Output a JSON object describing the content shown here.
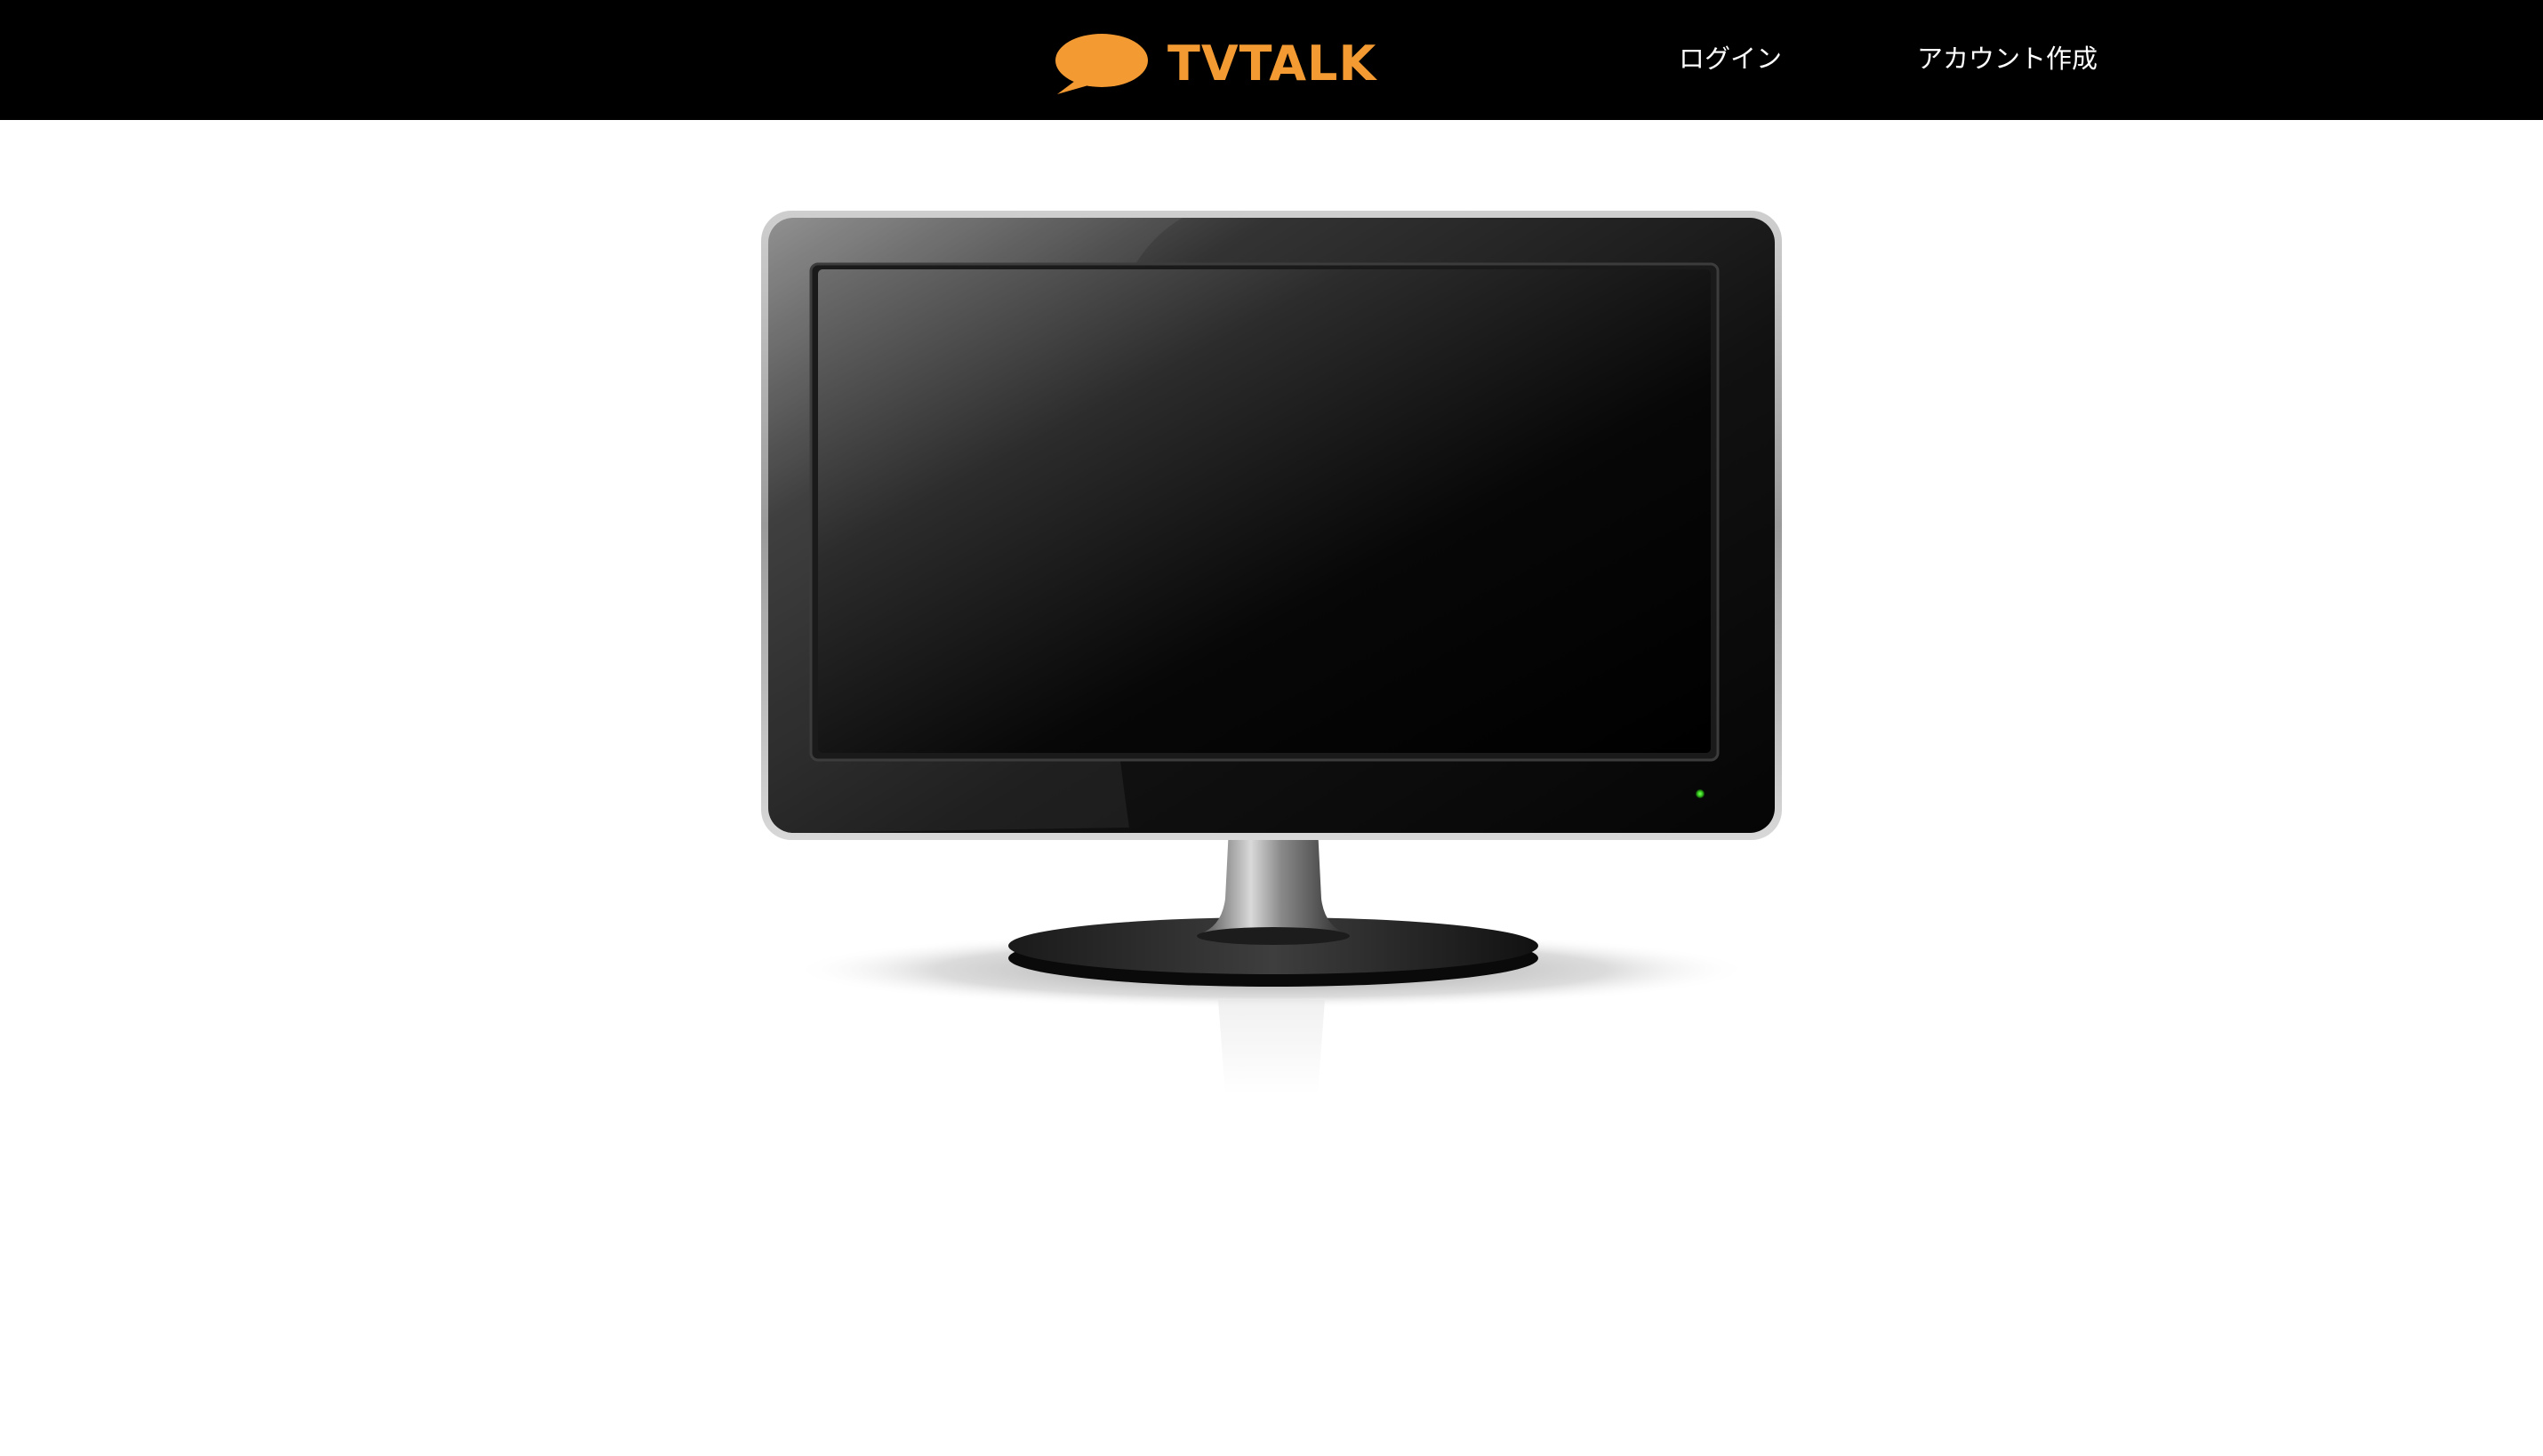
{
  "header": {
    "logo_text": "TVTALK",
    "logo_icon": "speech-bubble-icon",
    "login_label": "ログイン",
    "signup_label": "アカウント作成"
  },
  "colors": {
    "brand_orange": "#f39a33",
    "header_background": "#000000",
    "nav_text": "#ffffff",
    "page_background": "#ffffff",
    "power_indicator": "#38d020"
  },
  "main": {
    "illustration": "flat-screen-tv-icon"
  }
}
